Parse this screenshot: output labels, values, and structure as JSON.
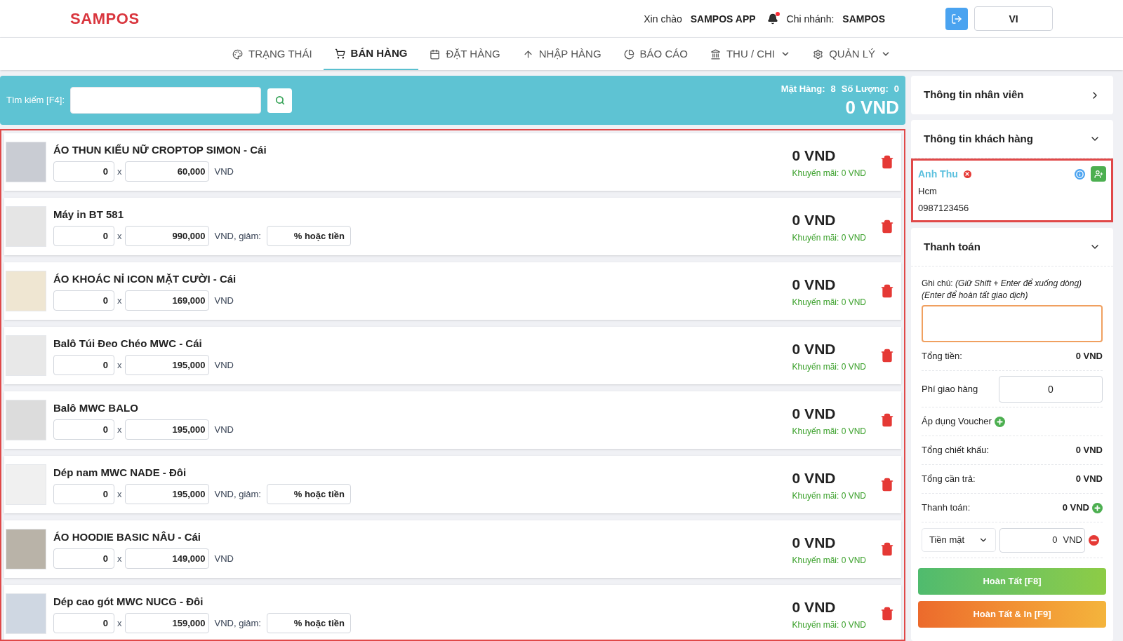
{
  "header": {
    "logo": "SAMPOS",
    "greeting": "Xin chào",
    "user": "SAMPOS APP",
    "notification": true,
    "branch_label": "Chi nhánh:",
    "branch": "SAMPOS",
    "language": "VI"
  },
  "nav": [
    {
      "label": "TRẠNG THÁI",
      "dropdown": false,
      "selected": false
    },
    {
      "label": "BÁN HÀNG",
      "dropdown": false,
      "selected": true
    },
    {
      "label": "ĐẶT HÀNG",
      "dropdown": false,
      "selected": false
    },
    {
      "label": "NHẬP HÀNG",
      "dropdown": false,
      "selected": false
    },
    {
      "label": "BÁO CÁO",
      "dropdown": false,
      "selected": false
    },
    {
      "label": "THU / CHI",
      "dropdown": true,
      "selected": false
    },
    {
      "label": "QUẢN LÝ",
      "dropdown": true,
      "selected": false
    }
  ],
  "search": {
    "label": "Tìm kiếm [F4]:"
  },
  "summary": {
    "items_label": "Mặt Hàng:",
    "items": "8",
    "qty_label": "Số Lượng:",
    "qty": "0",
    "total": "0 VND"
  },
  "cart": [
    {
      "name": "ÁO THUN KIỂU NỮ CROPTOP SIMON - Cái",
      "qty": "0",
      "x": "x",
      "price": "60,000",
      "suffix": "VND",
      "total": "0 VND",
      "promo": "Khuyến mãi: 0 VND"
    },
    {
      "name": "Máy in BT 581",
      "qty": "0",
      "x": "x",
      "price": "990,000",
      "suffix": "VND, giảm:",
      "discount_placeholder": "% hoặc tiền",
      "total": "0 VND",
      "promo": "Khuyến mãi: 0 VND"
    },
    {
      "name": "ÁO KHOÁC NỈ ICON MẶT CƯỜI - Cái",
      "qty": "0",
      "x": "x",
      "price": "169,000",
      "suffix": "VND",
      "total": "0 VND",
      "promo": "Khuyến mãi: 0 VND"
    },
    {
      "name": "Balô Túi Đeo Chéo MWC - Cái",
      "qty": "0",
      "x": "x",
      "price": "195,000",
      "suffix": "VND",
      "total": "0 VND",
      "promo": "Khuyến mãi: 0 VND"
    },
    {
      "name": "Balô MWC BALO",
      "qty": "0",
      "x": "x",
      "price": "195,000",
      "suffix": "VND",
      "total": "0 VND",
      "promo": "Khuyến mãi: 0 VND"
    },
    {
      "name": "Dép nam MWC NADE - Đôi",
      "qty": "0",
      "x": "x",
      "price": "195,000",
      "suffix": "VND, giảm:",
      "discount_placeholder": "% hoặc tiền",
      "total": "0 VND",
      "promo": "Khuyến mãi: 0 VND"
    },
    {
      "name": "ÁO HOODIE BASIC NÂU - Cái",
      "qty": "0",
      "x": "x",
      "price": "149,000",
      "suffix": "VND",
      "total": "0 VND",
      "promo": "Khuyến mãi: 0 VND"
    },
    {
      "name": "Dép cao gót MWC NUCG - Đôi",
      "qty": "0",
      "x": "x",
      "price": "159,000",
      "suffix": "VND, giảm:",
      "discount_placeholder": "% hoặc tiền",
      "total": "0 VND",
      "promo": "Khuyến mãi: 0 VND"
    }
  ],
  "staff_panel": {
    "title": "Thông tin nhân viên",
    "expanded": false
  },
  "customer_panel": {
    "title": "Thông tin khách hàng",
    "expanded": true,
    "name": "Anh Thu",
    "address": "Hcm",
    "phone": "0987123456"
  },
  "payment_panel": {
    "title": "Thanh toán",
    "expanded": true,
    "note_label": "Ghi chú:",
    "note_hint": "(Giữ Shift + Enter để xuống dòng) (Enter để hoàn tất giao dịch)",
    "rows": [
      {
        "kind": "value",
        "label": "Tổng tiền:",
        "value": "0 VND"
      },
      {
        "kind": "input",
        "label": "Phí giao hàng",
        "value": "0"
      },
      {
        "kind": "add",
        "label": "Áp dụng Voucher"
      },
      {
        "kind": "value",
        "label": "Tổng chiết khấu:",
        "value": "0 VND"
      },
      {
        "kind": "value",
        "label": "Tổng cần trả:",
        "value": "0 VND"
      },
      {
        "kind": "value_add",
        "label": "Thanh toán:",
        "value": "0 VND"
      }
    ],
    "method": "Tiền mặt",
    "method_amount": "0",
    "method_currency": "VND",
    "buttons": [
      {
        "label": "Hoàn Tất [F8]",
        "kind": "green"
      },
      {
        "label": "Hoàn Tất & In [F9]",
        "kind": "orange"
      }
    ]
  }
}
